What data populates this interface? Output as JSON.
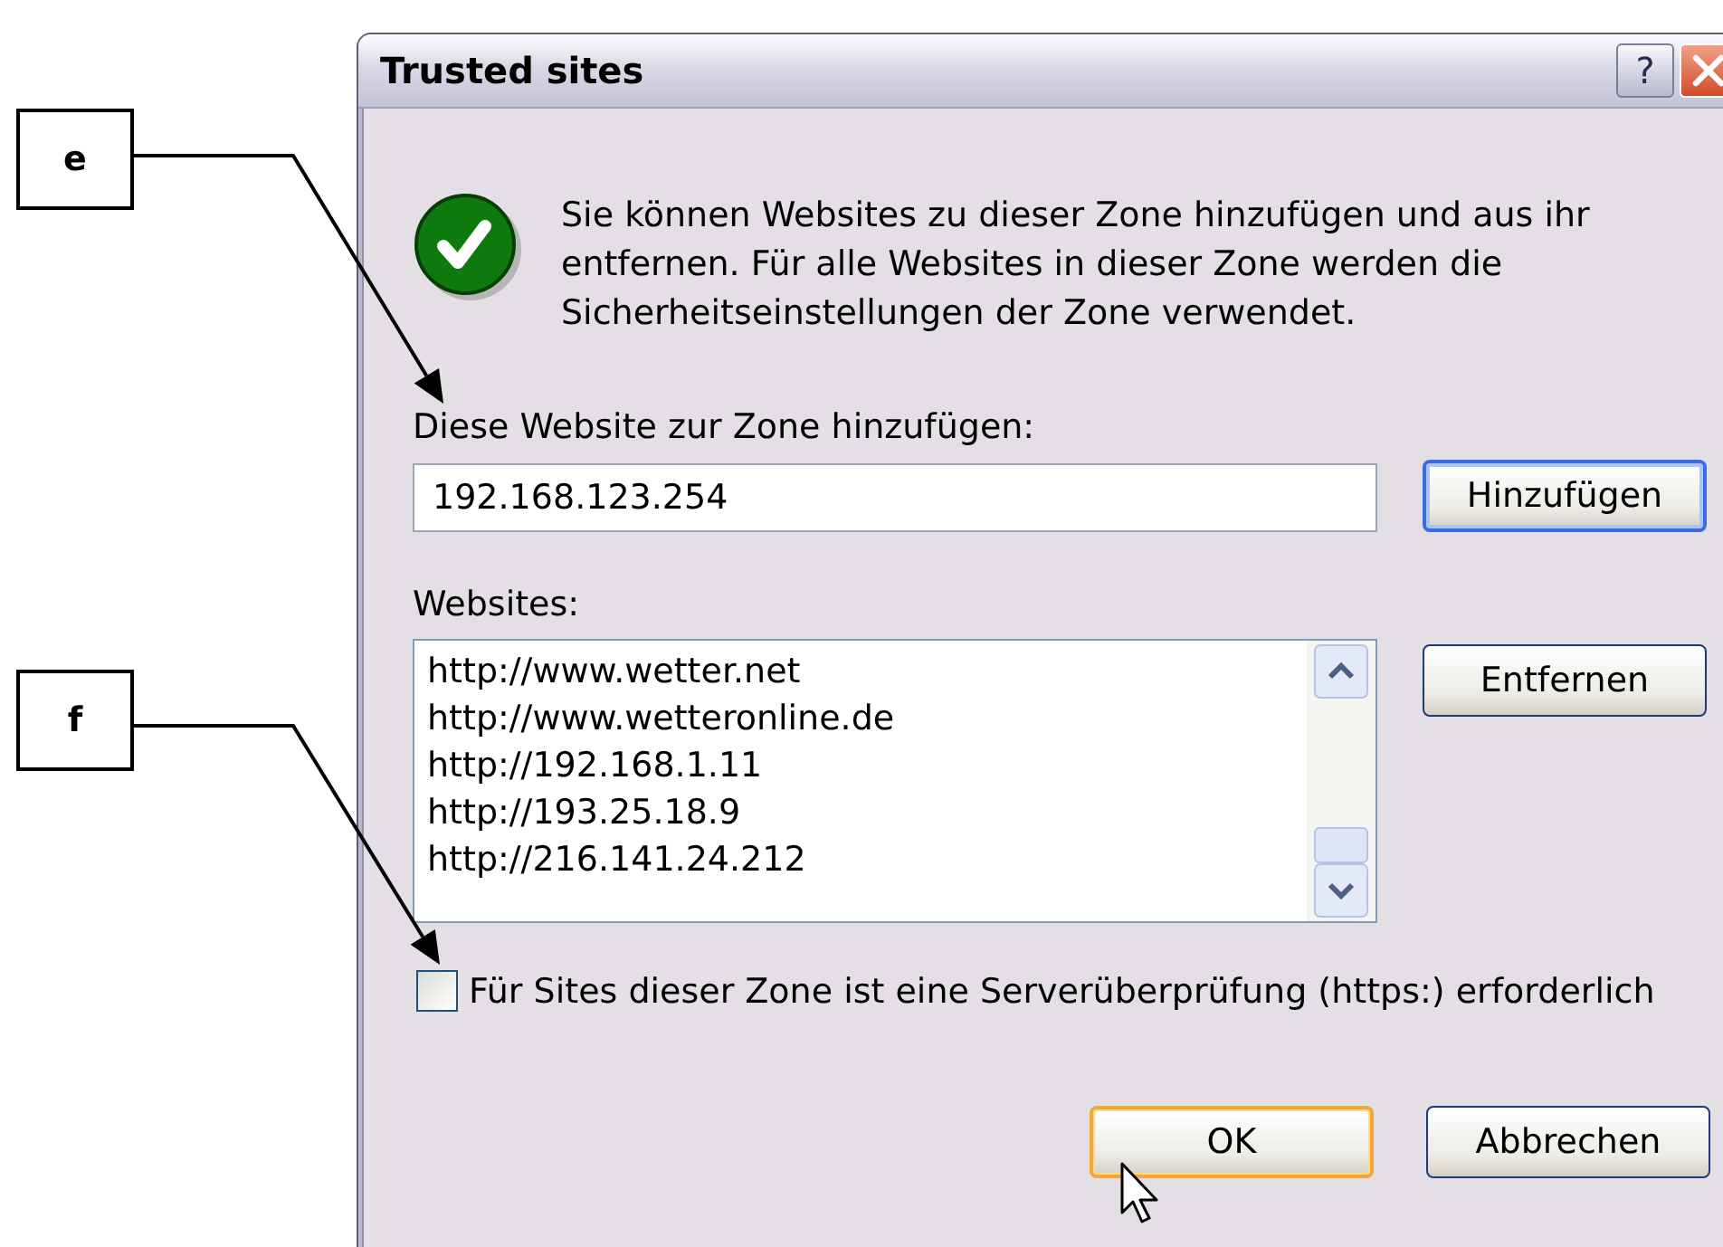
{
  "callouts": [
    {
      "label": "e"
    },
    {
      "label": "f"
    }
  ],
  "dialog": {
    "title": "Trusted sites",
    "help_button": "?",
    "description": "Sie können Websites zu dieser Zone hinzufügen und aus ihr entfernen. Für alle Websites in dieser Zone werden die Sicherheitseinstellungen der Zone verwendet.",
    "add_label": "Diese Website zur Zone hinzufügen:",
    "add_field": {
      "value": "192.168.123.254"
    },
    "add_button": {
      "label": "Hinzufügen",
      "default": true,
      "hot": false
    },
    "websites_label": "Websites:",
    "websites": [
      {
        "url": "http://www.wetter.net",
        "selected": false
      },
      {
        "url": "http://www.wetteronline.de",
        "selected": false
      },
      {
        "url": "http://192.168.1.11",
        "selected": false
      },
      {
        "url": "http://193.25.18.9",
        "selected": false
      },
      {
        "url": "http://216.141.24.212",
        "selected": false
      }
    ],
    "remove_button": {
      "label": "Entfernen",
      "default": false,
      "hot": false
    },
    "https_checkbox": {
      "label": "Für Sites dieser Zone ist eine Serverüberprüfung (https:) erforderlich",
      "checked": false
    },
    "buttons": [
      {
        "label": "OK",
        "default": false,
        "hot": true
      },
      {
        "label": "Abbrechen",
        "default": false,
        "hot": false
      }
    ]
  }
}
